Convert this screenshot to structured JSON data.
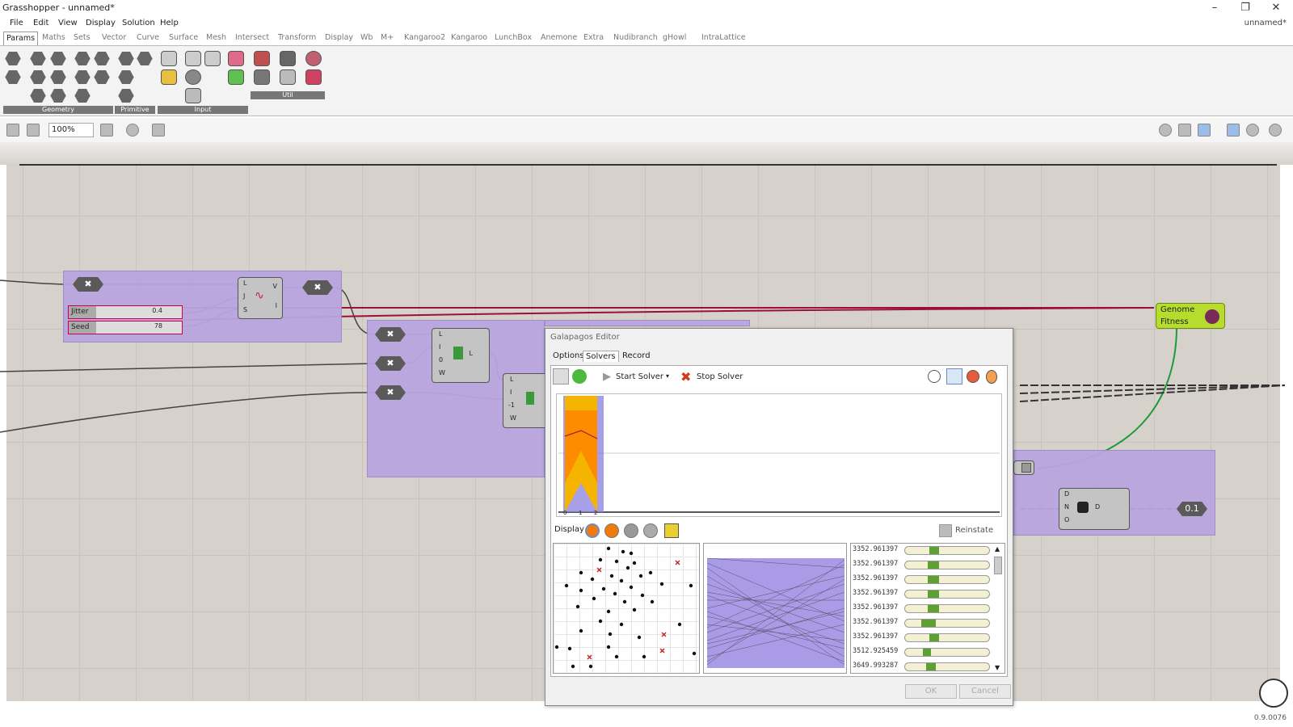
{
  "window": {
    "title": "Grasshopper - unnamed*",
    "doc_name": "unnamed*",
    "minimize": "–",
    "restore": "❐",
    "close": "✕"
  },
  "menu": [
    "File",
    "Edit",
    "View",
    "Display",
    "Solution",
    "Help"
  ],
  "tabs": [
    "Params",
    "Maths",
    "Sets",
    "Vector",
    "Curve",
    "Surface",
    "Mesh",
    "Intersect",
    "Transform",
    "Display",
    "Wb",
    "M+",
    "Kangaroo2",
    "Kangaroo",
    "LunchBox",
    "Anemone",
    "Extra",
    "Nudibranch",
    "gHowl",
    "IntraLattice"
  ],
  "ribbon_groups": {
    "geometry": "Geometry",
    "primitive": "Primitive",
    "input": "Input",
    "util": "Util"
  },
  "toolbar": {
    "zoom": "100%"
  },
  "canvas": {
    "hex_label": "✖",
    "jitter": {
      "label": "Jitter",
      "value": "0.4"
    },
    "seed": {
      "label": "Seed",
      "value": "78"
    },
    "jitter_comp_inputs": [
      "L",
      "J",
      "S"
    ],
    "jitter_comp_outputs": [
      "V",
      "I"
    ],
    "list_comp_inputs": [
      "L",
      "I",
      "0",
      "W"
    ],
    "list_comp_out": "L",
    "list_comp2_inputs": [
      "L",
      "I",
      "-1",
      "W"
    ],
    "genome": "Genome",
    "fitness": "Fitness",
    "dno_inputs": [
      "D",
      "N",
      "O"
    ],
    "dno_out": "D",
    "panel_value": "0.1"
  },
  "galapagos": {
    "title": "Galapagos Editor",
    "tabs": [
      "Options",
      "Solvers",
      "Record"
    ],
    "start": "Start Solver",
    "stop": "Stop Solver",
    "x_ticks": [
      "0",
      "1",
      "2"
    ],
    "display": "Display",
    "reinstate": "Reinstate",
    "ok": "OK",
    "cancel": "Cancel",
    "fitness": [
      {
        "v": "3352.961397",
        "s": 30,
        "w": 12
      },
      {
        "v": "3352.961397",
        "s": 28,
        "w": 14
      },
      {
        "v": "3352.961397",
        "s": 28,
        "w": 14
      },
      {
        "v": "3352.961397",
        "s": 28,
        "w": 14
      },
      {
        "v": "3352.961397",
        "s": 28,
        "w": 14
      },
      {
        "v": "3352.961397",
        "s": 20,
        "w": 18
      },
      {
        "v": "3352.961397",
        "s": 30,
        "w": 12
      },
      {
        "v": "3512.925459",
        "s": 22,
        "w": 10
      },
      {
        "v": "3649.993287",
        "s": 26,
        "w": 12
      }
    ]
  },
  "status": {
    "version": "0.9.0076"
  }
}
